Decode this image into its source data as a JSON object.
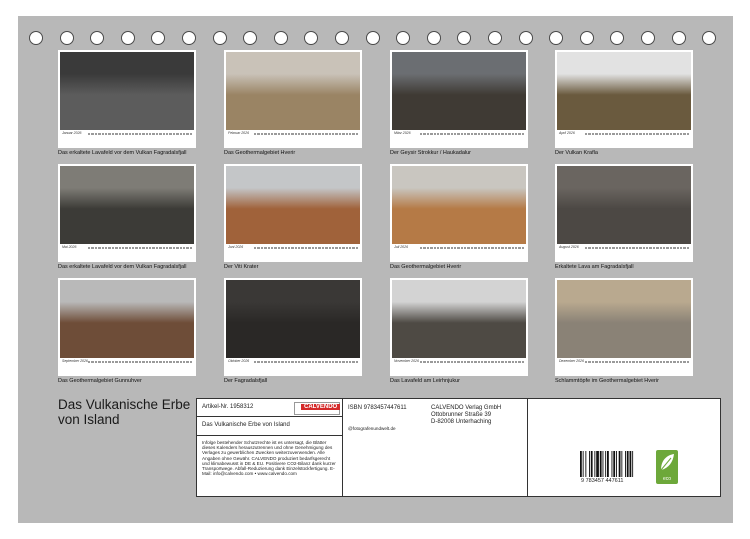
{
  "calendar": {
    "title": "Das Vulkanische Erbe von Island",
    "months": [
      {
        "label": "Januar 2026",
        "caption": "Das erkaltete Lavafeld vor dem Vulkan Fagradalsfjall",
        "sky": "#3a3a3a",
        "ground": "#5c5c5c"
      },
      {
        "label": "Februar 2026",
        "caption": "Das Geothermalgebiet Hverir",
        "sky": "#c9c2b8",
        "ground": "#9a8464"
      },
      {
        "label": "März 2026",
        "caption": "Der Geysir Strokkur / Haukadalur",
        "sky": "#6b6e72",
        "ground": "#3f3a34"
      },
      {
        "label": "April 2026",
        "caption": "Der Vulkan Krafla",
        "sky": "#e2e2e2",
        "ground": "#6a5a3e"
      },
      {
        "label": "Mai 2026",
        "caption": "Das erkaltete Lavafeld vor dem Vulkan Fagradalsfjall",
        "sky": "#7e7c76",
        "ground": "#3c3b37"
      },
      {
        "label": "Juni 2026",
        "caption": "Der Viti Krater",
        "sky": "#c4c6c8",
        "ground": "#a0623a"
      },
      {
        "label": "Juli 2026",
        "caption": "Das Geothermalgebiet Hverir",
        "sky": "#c9c6c0",
        "ground": "#b57a46"
      },
      {
        "label": "August 2026",
        "caption": "Erkaltete Lava am Fagradalsfjall",
        "sky": "#6a6560",
        "ground": "#4c4844"
      },
      {
        "label": "September 2026",
        "caption": "Das Geothermalgebiet Gunnuhver",
        "sky": "#b9b9b9",
        "ground": "#6e4d38"
      },
      {
        "label": "Oktober 2026",
        "caption": "Der Fagradalsfjall",
        "sky": "#3a3836",
        "ground": "#2a2826"
      },
      {
        "label": "November 2026",
        "caption": "Das Lavafeld am Leirhnjukur",
        "sky": "#d3d3d3",
        "ground": "#4e4a44"
      },
      {
        "label": "Dezember 2026",
        "caption": "Schlammtöpfe im Geothermalgebiet Hverir",
        "sky": "#b9a98f",
        "ground": "#8a8276"
      }
    ]
  },
  "info": {
    "article": "Artikel-Nr. 1958312",
    "isbn": "ISBN 9783457447611",
    "title_box": "Das Vulkanische Erbe von Island",
    "author": "@fotografenundwelt.de",
    "publisher_lines": [
      "CALVENDO Verlag GmbH",
      "Ottobrunner Straße 39",
      "D-82008 Unterhaching"
    ],
    "legal": "Infolge bestehender Schutzrechte ist es untersagt, die Blätter dieses Kalenders herauszutrennen und ohne Genehmigung des Verlages zu gewerblichen Zwecken weiterzuverwenden. Alle Angaben ohne Gewähr. CALVENDO produziert bedarfsgerecht und klimabewusst in DE & EU. Positivere CO2-Bilanz dank kurzer Transportwege. Abfall-Reduzierung dank Einzelstückfertigung. E-Mail: info@calvendo.com • www.calvendo.com",
    "logo_text": "CALVENDO",
    "barcode_digits": "9 783457 447611",
    "eco_label": "eco"
  },
  "colors": {
    "sheet": "#b8b8b8",
    "logo_red": "#d42a2a",
    "eco_green": "#6da83a"
  }
}
